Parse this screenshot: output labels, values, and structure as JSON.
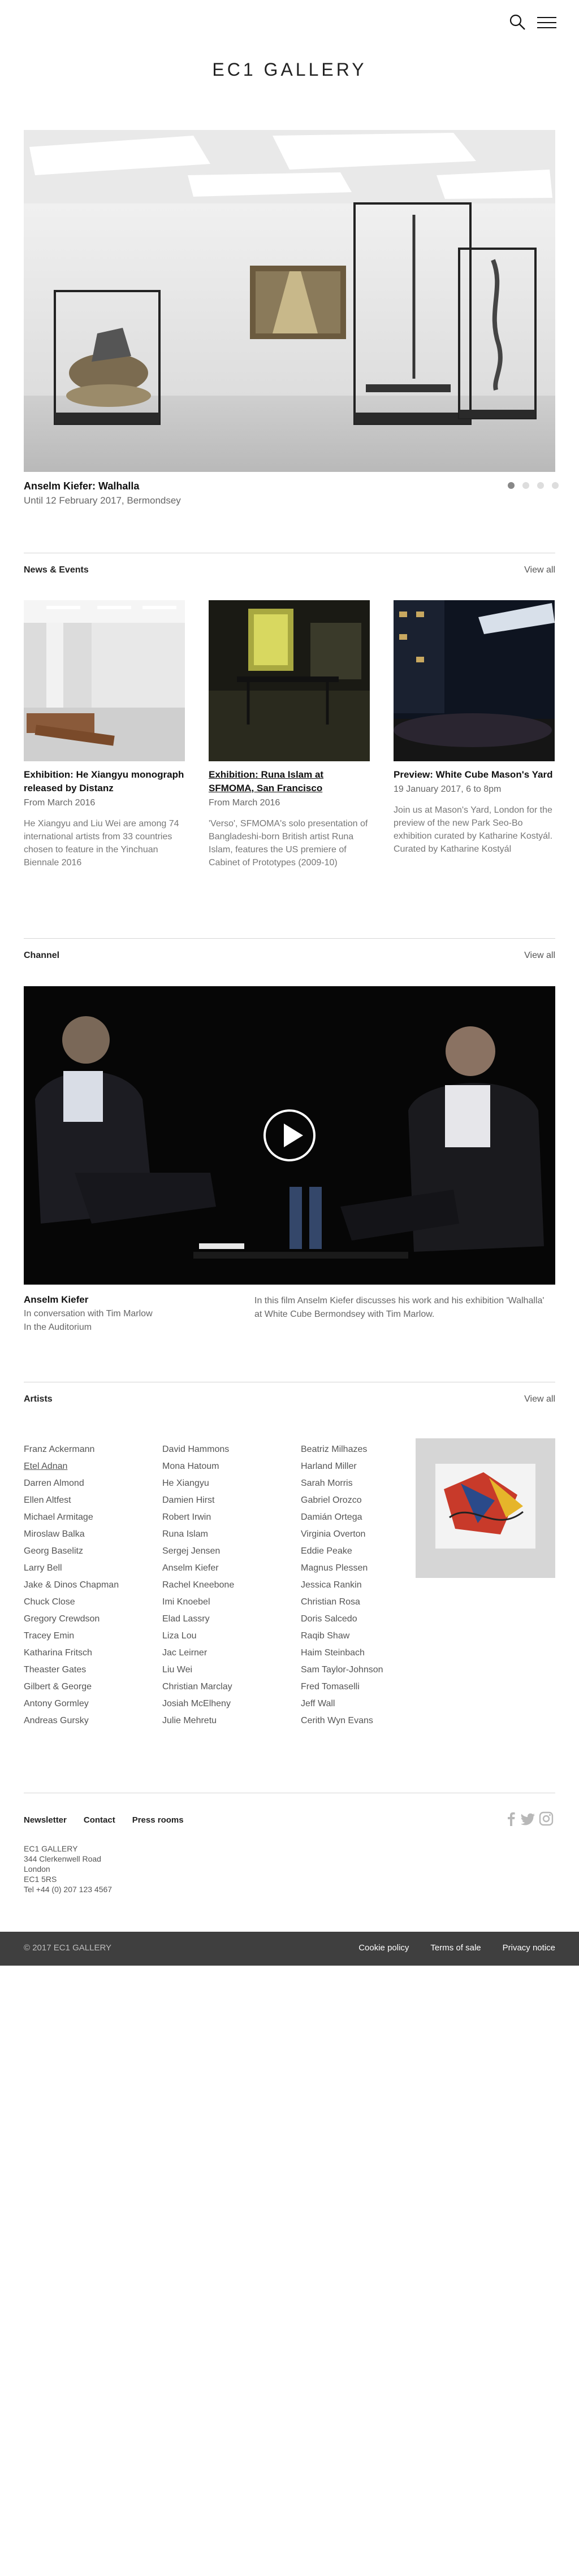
{
  "header": {
    "logo": "EC1 GALLERY",
    "icons": [
      "search-icon",
      "menu-icon"
    ]
  },
  "hero": {
    "title": "Anselm Kiefer: Walhalla",
    "subtitle": "Until 12 February 2017, Bermondsey",
    "slide_count": 4,
    "active_slide": 1
  },
  "news": {
    "section_title": "News & Events",
    "view_all": "View all",
    "items": [
      {
        "title": "Exhibition: He Xiangyu monograph released by Distanz",
        "date": "From March 2016",
        "desc": "He Xiangyu and Liu Wei are among 74 international artists from 33 countries chosen to feature in the Yinchuan Biennale 2016"
      },
      {
        "title": "Exhibition: Runa Islam at SFMOMA, San Francisco",
        "date": "From March 2016",
        "desc": "'Verso', SFMOMA's solo presentation of Bangladeshi-born British artist Runa Islam, features the US premiere of Cabinet of Prototypes (2009-10)"
      },
      {
        "title": "Preview: White Cube Mason's Yard",
        "date": "19 January 2017, 6 to 8pm",
        "desc": "Join us at Mason's Yard, London for the preview of the new Park Seo-Bo exhibition curated by Katharine Kostyál. Curated by Katharine Kostyál"
      }
    ]
  },
  "channel": {
    "section_title": "Channel",
    "view_all": "View all",
    "title": "Anselm Kiefer",
    "line1": "In conversation with Tim Marlow",
    "line2": "In the Auditorium",
    "desc": "In this film Anselm Kiefer discusses his work and his exhibition 'Walhalla' at White Cube Bermondsey with Tim Marlow."
  },
  "artists": {
    "section_title": "Artists",
    "view_all": "View all",
    "columns": [
      [
        "Franz Ackermann",
        "Etel Adnan",
        "Darren Almond",
        "Ellen Altfest",
        "Michael Armitage",
        "Miroslaw Balka",
        "Georg Baselitz",
        "Larry Bell",
        "Jake & Dinos Chapman",
        "Chuck Close",
        "Gregory Crewdson",
        "Tracey Emin",
        "Katharina Fritsch",
        "Theaster Gates",
        "Gilbert & George",
        "Antony Gormley",
        "Andreas Gursky"
      ],
      [
        "David Hammons",
        "Mona Hatoum",
        "He Xiangyu",
        "Damien Hirst",
        "Robert Irwin",
        "Runa Islam",
        "Sergej Jensen",
        "Anselm Kiefer",
        "Rachel Kneebone",
        "Imi Knoebel",
        "Elad Lassry",
        "Liza Lou",
        "Jac Leirner",
        "Liu Wei",
        "Christian Marclay",
        "Josiah McElheny",
        "Julie Mehretu"
      ],
      [
        "Beatriz Milhazes",
        "Harland Miller",
        "Sarah Morris",
        "Gabriel Orozco",
        "Damián Ortega",
        "Virginia Overton",
        "Eddie Peake",
        "Magnus Plessen",
        "Jessica Rankin",
        "Christian Rosa",
        "Doris Salcedo",
        "Raqib Shaw",
        "Haim Steinbach",
        "Sam Taylor-Johnson",
        "Fred Tomaselli",
        "Jeff Wall",
        "Cerith Wyn Evans"
      ]
    ]
  },
  "footer": {
    "links": [
      "Newsletter",
      "Contact",
      "Press rooms"
    ],
    "social": [
      "facebook-icon",
      "twitter-icon",
      "instagram-icon"
    ],
    "address": [
      "EC1 GALLERY",
      "344 Clerkenwell Road",
      "London",
      "EC1 5RS",
      "Tel +44 (0) 207 123 4567"
    ],
    "copyright": "© 2017 EC1 GALLERY",
    "bottom_links": [
      "Cookie policy",
      "Terms of sale",
      "Privacy notice"
    ]
  },
  "colors": {
    "bottom_bar": "#3f3f3f",
    "rule": "#d5d5d5",
    "text_muted": "#666666"
  }
}
